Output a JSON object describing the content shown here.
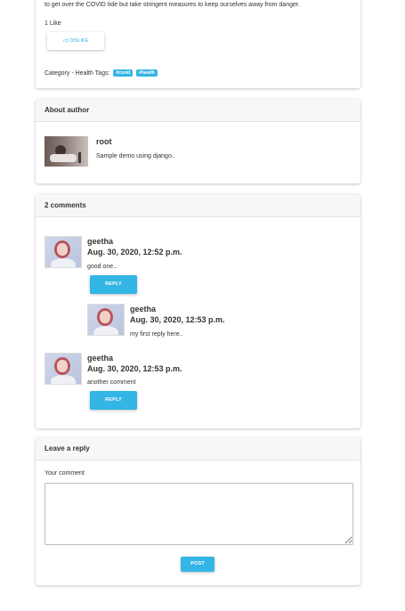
{
  "post": {
    "text_tail": "to get over the COVID tide but take stringent measures to keep ourselves away from danger.",
    "likes": "1 Like",
    "dislike_label": "DISLIKE",
    "category_label": "Category - Health Tags:",
    "tags": [
      "#covid",
      "#health"
    ]
  },
  "about": {
    "header": "About author",
    "name": "root",
    "bio": "Sample demo using django.."
  },
  "comments": {
    "header": "2 comments",
    "reply_label": "REPLY",
    "items": [
      {
        "author": "geetha",
        "date": "Aug. 30, 2020, 12:52 p.m.",
        "text": "good one.."
      },
      {
        "author": "geetha",
        "date": "Aug. 30, 2020, 12:53 p.m.",
        "text": "my first reply here.."
      },
      {
        "author": "geetha",
        "date": "Aug. 30, 2020, 12:53 p.m.",
        "text": "another comment"
      }
    ]
  },
  "reply_form": {
    "header": "Leave a reply",
    "label": "Your comment",
    "value": "",
    "post_label": "POST"
  },
  "colors": {
    "accent": "#33b5e5"
  }
}
